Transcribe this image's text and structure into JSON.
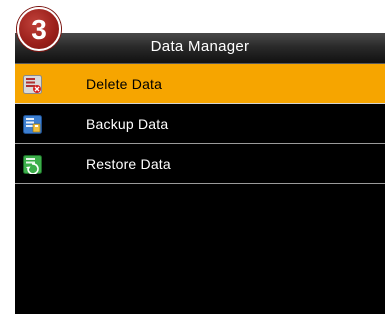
{
  "step_badge": "3",
  "window": {
    "title": "Data Manager"
  },
  "menu": {
    "items": [
      {
        "label": "Delete Data",
        "icon": "delete-data-icon",
        "selected": true
      },
      {
        "label": "Backup Data",
        "icon": "backup-data-icon",
        "selected": false
      },
      {
        "label": "Restore Data",
        "icon": "restore-data-icon",
        "selected": false
      }
    ]
  },
  "colors": {
    "selection": "#f6a500",
    "background": "#000000",
    "badge": "#9a1f1a"
  }
}
